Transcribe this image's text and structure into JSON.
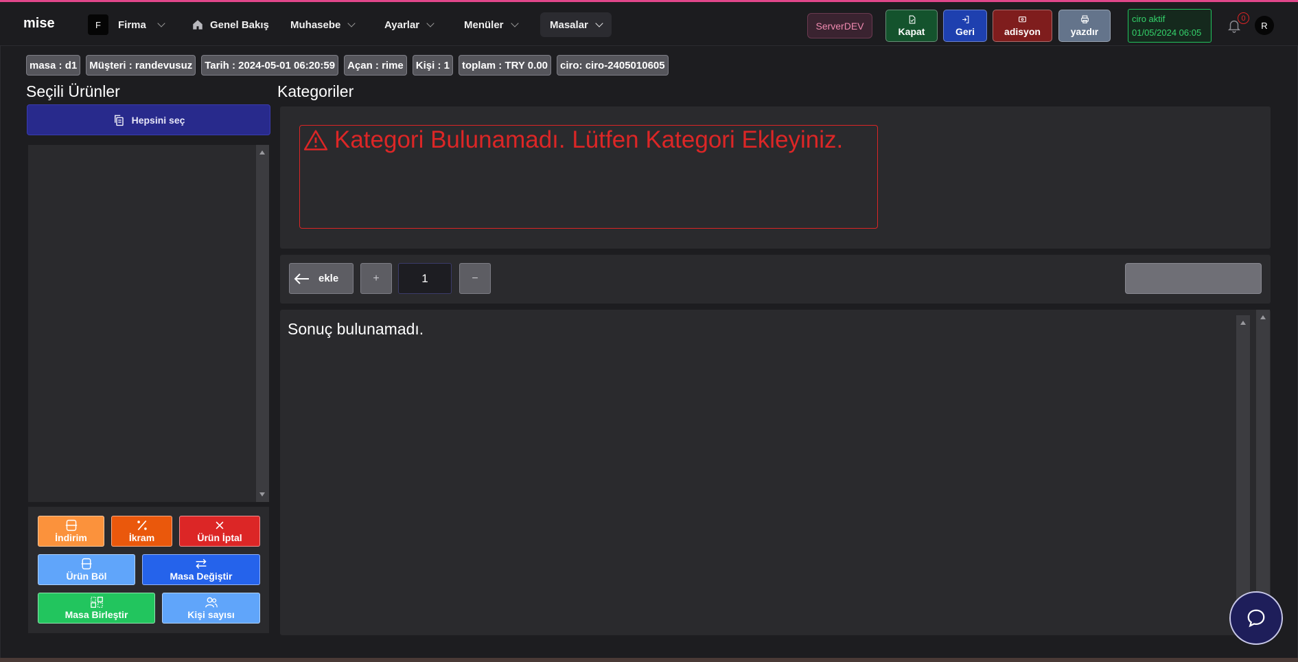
{
  "app": {
    "logo": "mise"
  },
  "nav": {
    "firm_badge": "F",
    "firm_label": "Firma",
    "overview_label": "Genel Bakış",
    "accounting_label": "Muhasebe",
    "settings_label": "Ayarlar",
    "menus_label": "Menüler",
    "tables_label": "Masalar"
  },
  "server_label": "ServerDEV",
  "actions": {
    "close_label": "Kapat",
    "back_label": "Geri",
    "bill_label": "adisyon",
    "print_label": "yazdır"
  },
  "ciro_status": {
    "line1": "ciro aktif",
    "line2": "01/05/2024 06:05"
  },
  "notifications": {
    "count": "0"
  },
  "user": {
    "initial": "R"
  },
  "chips": [
    "masa : d1",
    "Müşteri : randevusuz",
    "Tarih : 2024-05-01 06:20:59",
    "Açan : rime",
    "Kişi : 1",
    "toplam : TRY 0.00",
    "ciro: ciro-2405010605"
  ],
  "left": {
    "title": "Seçili Ürünler",
    "select_all_label": "Hepsini seç",
    "ops": {
      "discount": "İndirim",
      "treat": "İkram",
      "cancel": "Ürün İptal",
      "split": "Ürün Böl",
      "change_table": "Masa Değiştir",
      "merge_tables": "Masa Birleştir",
      "guest_count": "Kişi sayısı"
    }
  },
  "right": {
    "categories_title": "Kategoriler",
    "category_alert": "Kategori Bulunamadı. Lütfen Kategori Ekleyiniz.",
    "add_label": "ekle",
    "plus": "+",
    "minus": "−",
    "quantity": "1",
    "no_results": "Sonuç bulunamadı."
  },
  "colors": {
    "accent_pink": "#e0468a",
    "close_green": "#14532d",
    "back_blue": "#1e40af",
    "bill_red": "#7f1d1d",
    "print_gray": "#64748b",
    "ciro_green": "#22c55e",
    "alert_red": "#dc2626",
    "discount_orange": "#fb923c",
    "treat_orange": "#ea580c",
    "cancel_red": "#dc2626",
    "split_lightblue": "#60a5fa",
    "change_blue": "#2563eb",
    "merge_green": "#22c55e",
    "guests_lightblue": "#60a5fa"
  }
}
